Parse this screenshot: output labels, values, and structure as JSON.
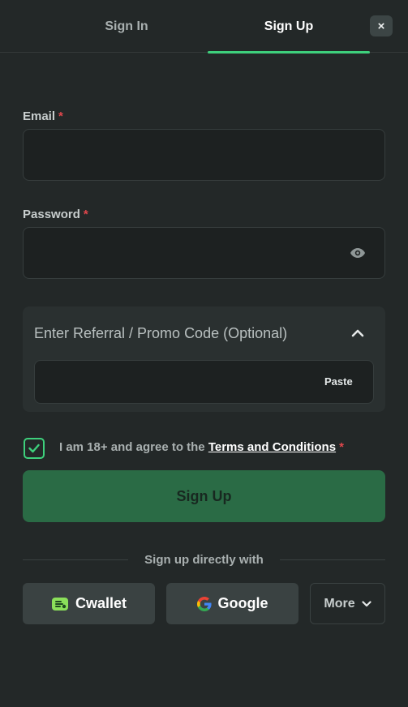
{
  "tabs": [
    {
      "label": "Sign In"
    },
    {
      "label": "Sign Up"
    }
  ],
  "close_label": "×",
  "email": {
    "label": "Email",
    "required": "*",
    "value": ""
  },
  "password": {
    "label": "Password",
    "required": "*",
    "value": ""
  },
  "promo": {
    "title": "Enter Referral / Promo Code (Optional)",
    "paste_label": "Paste",
    "value": ""
  },
  "agree": {
    "prefix": "I am 18+ and agree to the ",
    "link": "Terms and Conditions",
    "required": "*",
    "checked": true
  },
  "submit_label": "Sign Up",
  "divider_text": "Sign up directly with",
  "sso": {
    "cwallet": "Cwallet",
    "google": "Google",
    "more": "More"
  },
  "colors": {
    "accent": "#3ed07c",
    "submit_bg": "#2a6b45",
    "required": "#e0474c",
    "background": "#232828"
  },
  "icons": [
    "close-icon",
    "eye-icon",
    "chevron-up-icon",
    "check-icon",
    "cwallet-icon",
    "google-icon",
    "chevron-down-icon"
  ]
}
